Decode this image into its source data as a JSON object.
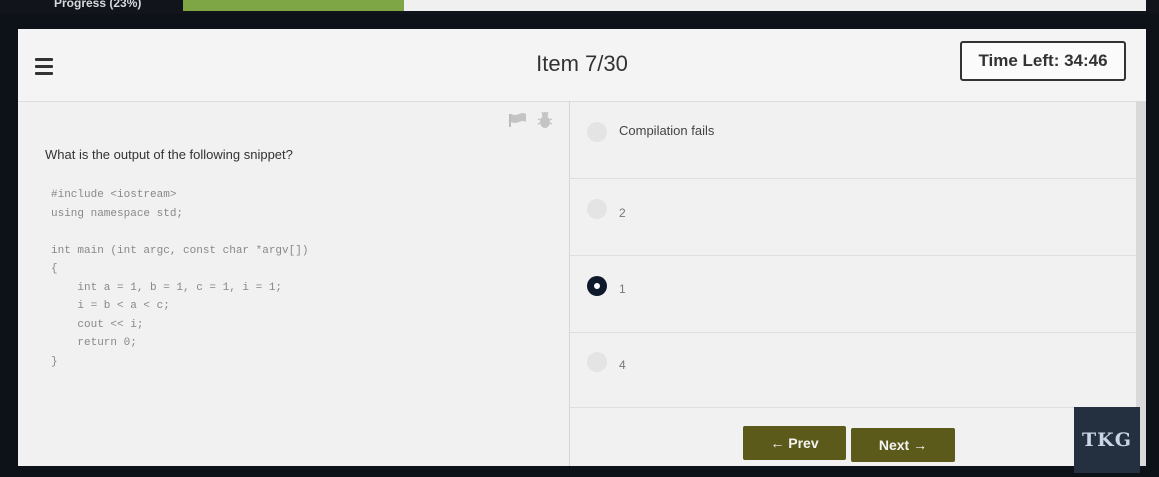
{
  "progress": {
    "label": "Progress (23%)",
    "percent": 23,
    "fill_color": "#7fa644"
  },
  "header": {
    "menu_icon": "hamburger-icon",
    "item_title": "Item 7/30",
    "time_left": "Time Left: 34:46"
  },
  "question": {
    "tools": [
      "flag-icon",
      "bug-icon"
    ],
    "text": "What is the output of the following snippet?",
    "code": "#include <iostream>\nusing namespace std;\n\nint main (int argc, const char *argv[])\n{\n    int a = 1, b = 1, c = 1, i = 1;\n    i = b < a < c;\n    cout << i;\n    return 0;\n}"
  },
  "answers": [
    {
      "label": "Compilation fails",
      "selected": false
    },
    {
      "label": "2",
      "selected": false
    },
    {
      "label": "1",
      "selected": true
    },
    {
      "label": "4",
      "selected": false
    }
  ],
  "nav": {
    "prev_label": "← Prev",
    "next_label": "Next →"
  },
  "logo": {
    "text": "TKG"
  }
}
